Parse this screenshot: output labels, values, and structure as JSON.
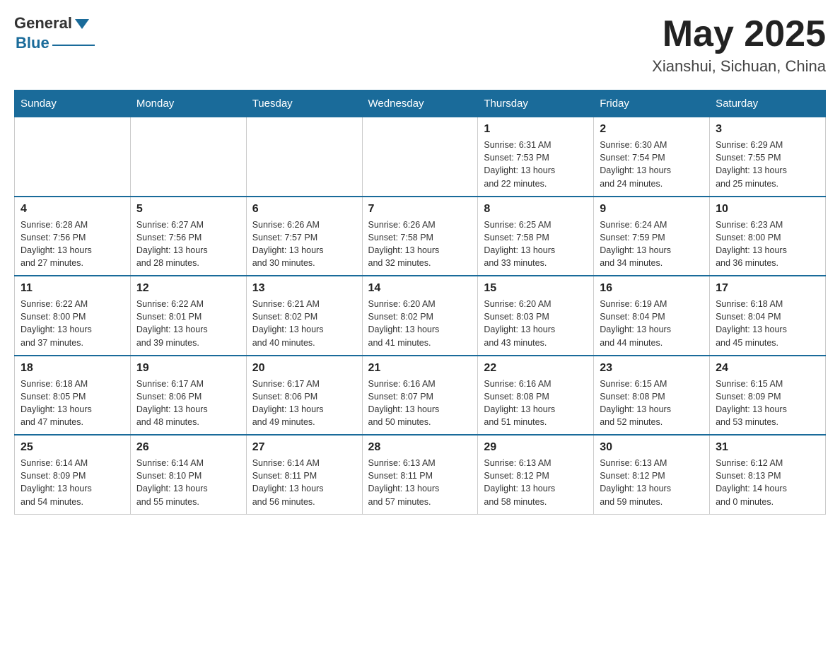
{
  "header": {
    "logo_general": "General",
    "logo_blue": "Blue",
    "month_title": "May 2025",
    "location": "Xianshui, Sichuan, China"
  },
  "days_of_week": [
    "Sunday",
    "Monday",
    "Tuesday",
    "Wednesday",
    "Thursday",
    "Friday",
    "Saturday"
  ],
  "weeks": [
    [
      {
        "day": "",
        "info": ""
      },
      {
        "day": "",
        "info": ""
      },
      {
        "day": "",
        "info": ""
      },
      {
        "day": "",
        "info": ""
      },
      {
        "day": "1",
        "info": "Sunrise: 6:31 AM\nSunset: 7:53 PM\nDaylight: 13 hours\nand 22 minutes."
      },
      {
        "day": "2",
        "info": "Sunrise: 6:30 AM\nSunset: 7:54 PM\nDaylight: 13 hours\nand 24 minutes."
      },
      {
        "day": "3",
        "info": "Sunrise: 6:29 AM\nSunset: 7:55 PM\nDaylight: 13 hours\nand 25 minutes."
      }
    ],
    [
      {
        "day": "4",
        "info": "Sunrise: 6:28 AM\nSunset: 7:56 PM\nDaylight: 13 hours\nand 27 minutes."
      },
      {
        "day": "5",
        "info": "Sunrise: 6:27 AM\nSunset: 7:56 PM\nDaylight: 13 hours\nand 28 minutes."
      },
      {
        "day": "6",
        "info": "Sunrise: 6:26 AM\nSunset: 7:57 PM\nDaylight: 13 hours\nand 30 minutes."
      },
      {
        "day": "7",
        "info": "Sunrise: 6:26 AM\nSunset: 7:58 PM\nDaylight: 13 hours\nand 32 minutes."
      },
      {
        "day": "8",
        "info": "Sunrise: 6:25 AM\nSunset: 7:58 PM\nDaylight: 13 hours\nand 33 minutes."
      },
      {
        "day": "9",
        "info": "Sunrise: 6:24 AM\nSunset: 7:59 PM\nDaylight: 13 hours\nand 34 minutes."
      },
      {
        "day": "10",
        "info": "Sunrise: 6:23 AM\nSunset: 8:00 PM\nDaylight: 13 hours\nand 36 minutes."
      }
    ],
    [
      {
        "day": "11",
        "info": "Sunrise: 6:22 AM\nSunset: 8:00 PM\nDaylight: 13 hours\nand 37 minutes."
      },
      {
        "day": "12",
        "info": "Sunrise: 6:22 AM\nSunset: 8:01 PM\nDaylight: 13 hours\nand 39 minutes."
      },
      {
        "day": "13",
        "info": "Sunrise: 6:21 AM\nSunset: 8:02 PM\nDaylight: 13 hours\nand 40 minutes."
      },
      {
        "day": "14",
        "info": "Sunrise: 6:20 AM\nSunset: 8:02 PM\nDaylight: 13 hours\nand 41 minutes."
      },
      {
        "day": "15",
        "info": "Sunrise: 6:20 AM\nSunset: 8:03 PM\nDaylight: 13 hours\nand 43 minutes."
      },
      {
        "day": "16",
        "info": "Sunrise: 6:19 AM\nSunset: 8:04 PM\nDaylight: 13 hours\nand 44 minutes."
      },
      {
        "day": "17",
        "info": "Sunrise: 6:18 AM\nSunset: 8:04 PM\nDaylight: 13 hours\nand 45 minutes."
      }
    ],
    [
      {
        "day": "18",
        "info": "Sunrise: 6:18 AM\nSunset: 8:05 PM\nDaylight: 13 hours\nand 47 minutes."
      },
      {
        "day": "19",
        "info": "Sunrise: 6:17 AM\nSunset: 8:06 PM\nDaylight: 13 hours\nand 48 minutes."
      },
      {
        "day": "20",
        "info": "Sunrise: 6:17 AM\nSunset: 8:06 PM\nDaylight: 13 hours\nand 49 minutes."
      },
      {
        "day": "21",
        "info": "Sunrise: 6:16 AM\nSunset: 8:07 PM\nDaylight: 13 hours\nand 50 minutes."
      },
      {
        "day": "22",
        "info": "Sunrise: 6:16 AM\nSunset: 8:08 PM\nDaylight: 13 hours\nand 51 minutes."
      },
      {
        "day": "23",
        "info": "Sunrise: 6:15 AM\nSunset: 8:08 PM\nDaylight: 13 hours\nand 52 minutes."
      },
      {
        "day": "24",
        "info": "Sunrise: 6:15 AM\nSunset: 8:09 PM\nDaylight: 13 hours\nand 53 minutes."
      }
    ],
    [
      {
        "day": "25",
        "info": "Sunrise: 6:14 AM\nSunset: 8:09 PM\nDaylight: 13 hours\nand 54 minutes."
      },
      {
        "day": "26",
        "info": "Sunrise: 6:14 AM\nSunset: 8:10 PM\nDaylight: 13 hours\nand 55 minutes."
      },
      {
        "day": "27",
        "info": "Sunrise: 6:14 AM\nSunset: 8:11 PM\nDaylight: 13 hours\nand 56 minutes."
      },
      {
        "day": "28",
        "info": "Sunrise: 6:13 AM\nSunset: 8:11 PM\nDaylight: 13 hours\nand 57 minutes."
      },
      {
        "day": "29",
        "info": "Sunrise: 6:13 AM\nSunset: 8:12 PM\nDaylight: 13 hours\nand 58 minutes."
      },
      {
        "day": "30",
        "info": "Sunrise: 6:13 AM\nSunset: 8:12 PM\nDaylight: 13 hours\nand 59 minutes."
      },
      {
        "day": "31",
        "info": "Sunrise: 6:12 AM\nSunset: 8:13 PM\nDaylight: 14 hours\nand 0 minutes."
      }
    ]
  ]
}
